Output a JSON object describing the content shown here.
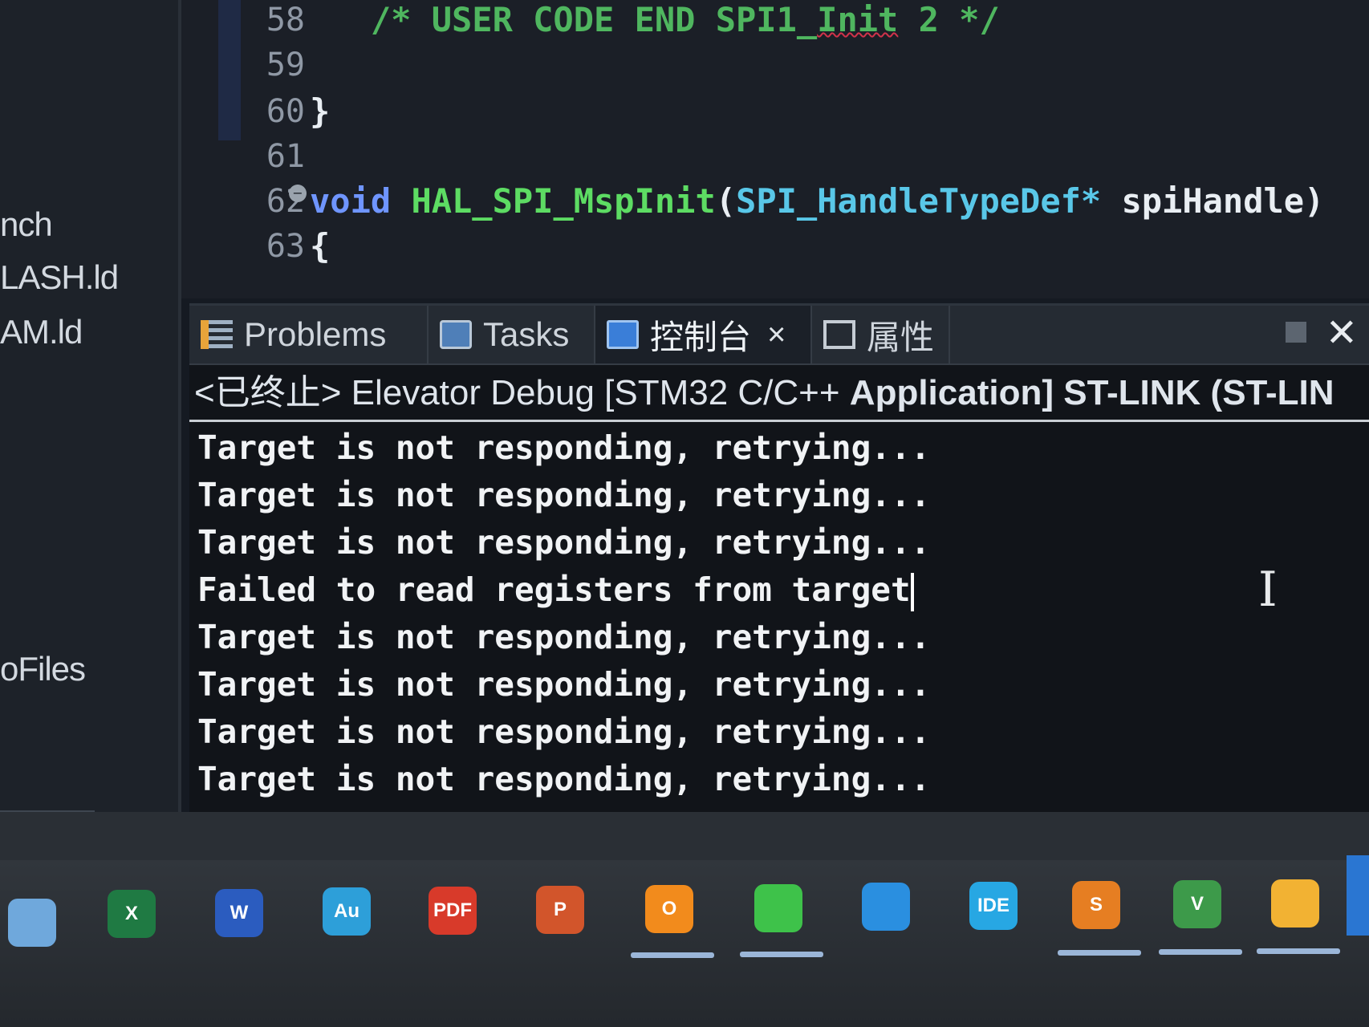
{
  "explorer": {
    "items": [
      "nch",
      "LASH.ld",
      "AM.ld",
      "oFiles"
    ]
  },
  "editor": {
    "lines": [
      {
        "no": "58",
        "parts": [
          {
            "t": "   /* USER CODE END SPI1_",
            "c": "comment"
          },
          {
            "t": "Init",
            "c": "comment-squiggle"
          },
          {
            "t": " 2 */",
            "c": "comment"
          }
        ]
      },
      {
        "no": "59",
        "parts": []
      },
      {
        "no": "60",
        "parts": [
          {
            "t": "}",
            "c": "plain"
          }
        ]
      },
      {
        "no": "61",
        "parts": []
      },
      {
        "no": "62",
        "parts": [
          {
            "t": "void ",
            "c": "kw"
          },
          {
            "t": "HAL_SPI_MspInit",
            "c": "fn"
          },
          {
            "t": "(",
            "c": "plain"
          },
          {
            "t": "SPI_HandleTypeDef*",
            "c": "type"
          },
          {
            "t": " spiHandle)",
            "c": "plain"
          }
        ],
        "fold": true
      },
      {
        "no": "63",
        "parts": [
          {
            "t": "{",
            "c": "plain"
          }
        ]
      }
    ]
  },
  "panel": {
    "tabs": [
      {
        "label": "Problems",
        "icon": "problems-icon"
      },
      {
        "label": "Tasks",
        "icon": "tasks-icon"
      },
      {
        "label": "控制台",
        "icon": "console-icon",
        "active": true,
        "close": "×"
      },
      {
        "label": "属性",
        "icon": "properties-icon"
      }
    ],
    "close_glyph": "✕",
    "session_status": "<已终止>",
    "session_name": " Elevator Debug [STM32 C/C++ ",
    "session_bold": "Application] ST-LINK (ST-LIN"
  },
  "console": {
    "lines": [
      "Target is not responding, retrying...",
      "Target is not responding, retrying...",
      "Target is not responding, retrying...",
      "Failed to read registers from target",
      "Target is not responding, retrying...",
      "Target is not responding, retrying...",
      "Target is not responding, retrying...",
      "Target is not responding, retrying..."
    ]
  },
  "taskbar": {
    "apps": [
      {
        "name": "this-pc",
        "label": "",
        "color": "#6fa8dc"
      },
      {
        "name": "excel",
        "label": "X",
        "color": "#1f7a43"
      },
      {
        "name": "word",
        "label": "W",
        "color": "#2b5cbf"
      },
      {
        "name": "audition",
        "label": "Au",
        "color": "#2d9fd9"
      },
      {
        "name": "pdf-reader",
        "label": "PDF",
        "color": "#d83a2a"
      },
      {
        "name": "powerpoint",
        "label": "P",
        "color": "#d2552b"
      },
      {
        "name": "opera-store",
        "label": "O",
        "color": "#f28b1c"
      },
      {
        "name": "wechat",
        "label": "",
        "color": "#3ec24a"
      },
      {
        "name": "vscode",
        "label": "",
        "color": "#2a8fe0"
      },
      {
        "name": "ide",
        "label": "IDE",
        "color": "#27a7e3"
      },
      {
        "name": "sublime",
        "label": "S",
        "color": "#e67e22"
      },
      {
        "name": "visio",
        "label": "V",
        "color": "#3d9a4a"
      },
      {
        "name": "file-explorer",
        "label": "",
        "color": "#f2b233"
      }
    ]
  }
}
